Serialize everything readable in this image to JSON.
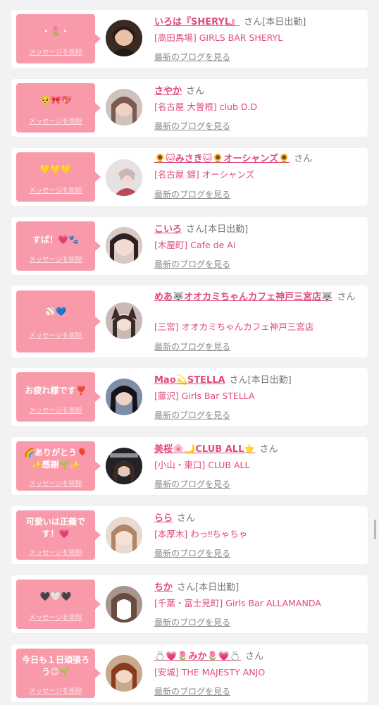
{
  "cards": [
    {
      "bubble": "・🌷・",
      "delete": "メッセージを削除",
      "name": "いろは『SHERYL』",
      "san": "さん",
      "status": "[本日出勤]",
      "shop": "[高田馬場] GIRLS BAR SHERYL",
      "blog": "最新のブログを見る"
    },
    {
      "bubble": "🥺🎀💖",
      "delete": "メッセージを削除",
      "name": "さやか",
      "san": "さん",
      "status": "",
      "shop": "[名古屋 大曽根] club D.D",
      "blog": "最新のブログを見る"
    },
    {
      "bubble": "💛💛💛",
      "delete": "メッセージを削除",
      "name": "🌻🐱みさき🐱🌻オーシャンズ🌻",
      "san": "さん",
      "status": "",
      "shop": "[名古屋 錦] オーシャンズ",
      "blog": "最新のブログを見る"
    },
    {
      "bubble": "すぱ！💗🐾",
      "delete": "メッセージを削除",
      "name": "こいろ",
      "san": "さん",
      "status": "[本日出勤]",
      "shop": "[木屋町] Cafe de Ai",
      "blog": "最新のブログを見る"
    },
    {
      "bubble": "⚾💙",
      "delete": "メッセージを削除",
      "name": "めあ🐺オオカミちゃんカフェ神戸三宮店🐺",
      "san": "さん",
      "status": "",
      "shop": "[三宮] オオカミちゃんカフェ神戸三宮店",
      "blog": "最新のブログを見る"
    },
    {
      "bubble": "お疲れ様です❣️",
      "delete": "メッセージを削除",
      "name": "Mao💫STELLA",
      "san": "さん",
      "status": "[本日出勤]",
      "shop": "[藤沢] Girls Bar STELLA",
      "blog": "最新のブログを見る"
    },
    {
      "bubble": "🌈ありがとう🎈\n✨感謝🌱✨",
      "delete": "メッセージを削除",
      "name": "美桜🌸🌙CLUB ALL⭐",
      "san": "さん",
      "status": "",
      "shop": "[小山・東口] CLUB ALL",
      "blog": "最新のブログを見る"
    },
    {
      "bubble": "可愛いは正義で\nす！💗",
      "delete": "メッセージを削除",
      "name": "らら",
      "san": "さん",
      "status": "",
      "shop": "[本厚木] わっ‼ちゃちゃ",
      "blog": "最新のブログを見る"
    },
    {
      "bubble": "🖤🤍🖤",
      "delete": "メッセージを削除",
      "name": "ちか",
      "san": "さん",
      "status": "[本日出勤]",
      "shop": "[千葉・富士見町] Girls Bar ALLAMANDA",
      "blog": "最新のブログを見る"
    },
    {
      "bubble": "今日も１日頑張ろ\nう😊🌱",
      "delete": "メッセージを削除",
      "name": "💍💗🌷みか🌷💗💍",
      "san": "さん",
      "status": "",
      "shop": "[安城] THE MAJESTY ANJO",
      "blog": "最新のブログを見る"
    }
  ],
  "colors": {
    "accent": "#e14b78",
    "bubble": "#f99aaa",
    "background": "#f2f2f3"
  }
}
